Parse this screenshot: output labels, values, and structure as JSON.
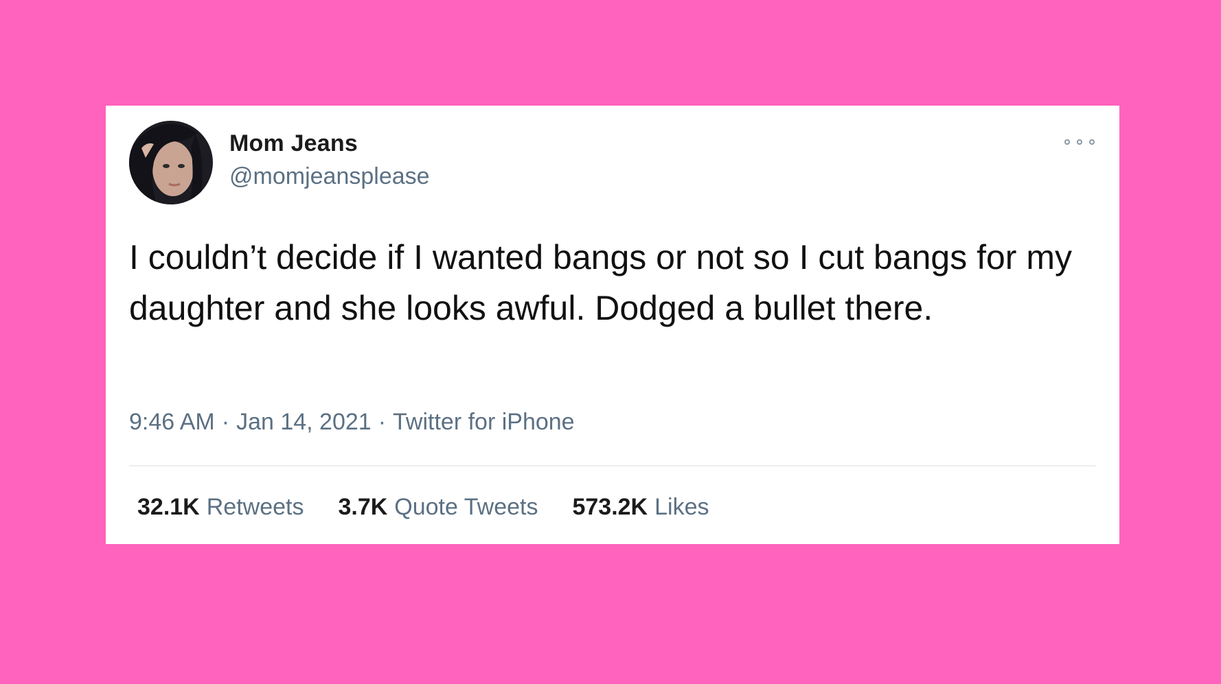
{
  "colors": {
    "background": "#ff63bd",
    "card": "#ffffff",
    "primary_text": "#111111",
    "secondary_text": "#5b7083"
  },
  "tweet": {
    "author": {
      "display_name": "Mom Jeans",
      "handle": "@momjeansplease",
      "avatar": "profile-photo"
    },
    "more_icon": "more-options-icon",
    "text": "I couldn’t decide if I wanted bangs or not so I cut bangs for my daughter and she looks awful. Dodged a bullet there.",
    "time": "9:46 AM",
    "date": "Jan 14, 2021",
    "source": "Twitter for iPhone",
    "separator": "·",
    "stats": {
      "retweets": {
        "count": "32.1K",
        "label": "Retweets"
      },
      "quote_tweets": {
        "count": "3.7K",
        "label": "Quote Tweets"
      },
      "likes": {
        "count": "573.2K",
        "label": "Likes"
      }
    }
  }
}
